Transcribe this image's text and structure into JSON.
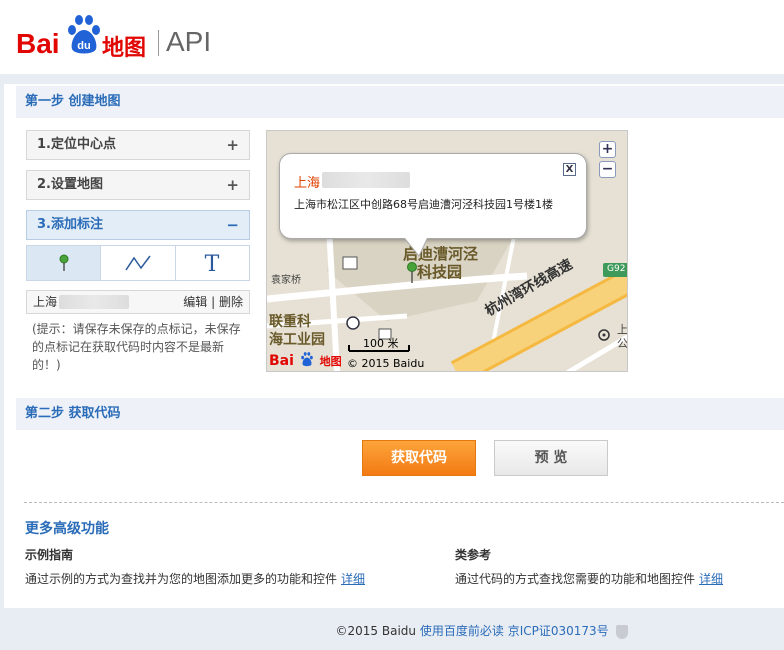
{
  "logo": {
    "bai": "Bai",
    "du": "du",
    "ditu": "地图",
    "api": "API"
  },
  "step1": {
    "title": "第一步 创建地图",
    "items": [
      {
        "label": "1.定位中心点",
        "symbol": "+"
      },
      {
        "label": "2.设置地图",
        "symbol": "+"
      },
      {
        "label": "3.添加标注",
        "symbol": "−"
      }
    ],
    "tools": [
      "marker-tool-icon",
      "polyline-tool-icon",
      "text-tool-icon"
    ],
    "text_tool_glyph": "T",
    "marker": {
      "name": "上海",
      "edit": "编辑",
      "sep": "|",
      "delete": "删除"
    },
    "hint": "(提示：请保存未保存的点标记，未保存的点标记在获取代码时内容不是最新的！)"
  },
  "map": {
    "popup_title": "上海",
    "popup_address": "上海市松江区中创路68号启迪漕河泾科技园1号楼1楼",
    "close_symbol": "X",
    "zoom_in": "+",
    "zoom_out": "−",
    "poi_label_1": "启迪漕河泾",
    "poi_label_2": "科技园",
    "label_yuanjiaqiao": "袁家桥",
    "label_lianchong_1": "联重科",
    "label_lianchong_2": "海工业园",
    "highway_label": "杭州湾环线高速",
    "highway_code": "G92",
    "right_label_1": "上",
    "right_label_2": "公",
    "scale": "100 米",
    "copyright": "© 2015 Baidu",
    "logo_bai": "Bai",
    "logo_ditu": "地图"
  },
  "step2": {
    "title": "第二步 获取代码",
    "get_code": "获取代码",
    "preview": "预 览"
  },
  "advanced": {
    "title": "更多高级功能",
    "examples_title": "示例指南",
    "examples_desc": "通过示例的方式为查找并为您的地图添加更多的功能和控件",
    "examples_link": "详细",
    "classref_title": "类参考",
    "classref_desc": "通过代码的方式查找您需要的功能和地图控件",
    "classref_link": "详细"
  },
  "footer": {
    "copyright": "©2015 Baidu",
    "terms": "使用百度前必读",
    "icp": "京ICP证030173号"
  },
  "colors": {
    "brand_red": "#e10602",
    "link_blue": "#2b6cb8",
    "orange_button": "#f37a12"
  }
}
